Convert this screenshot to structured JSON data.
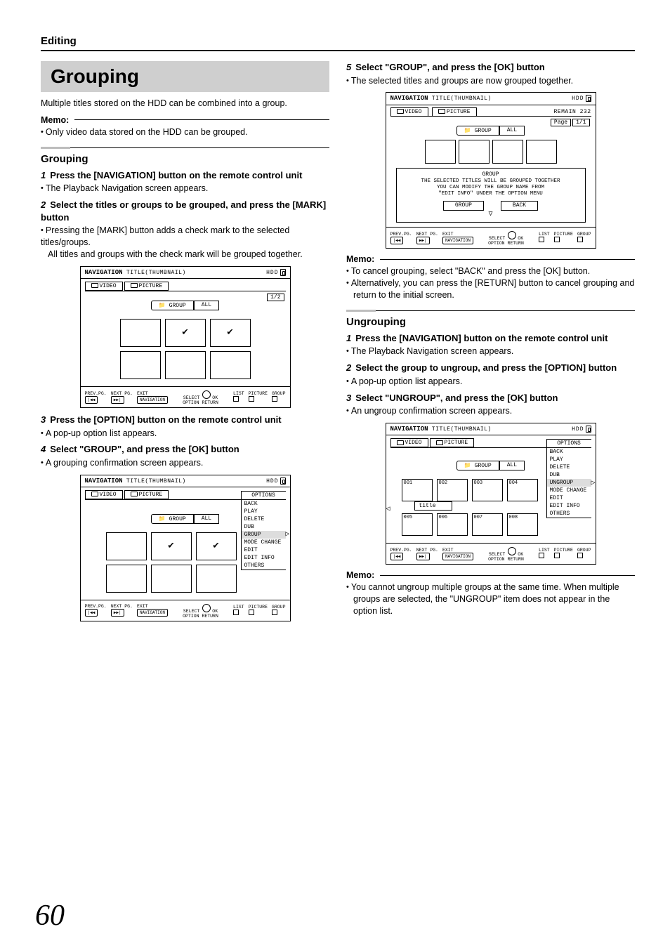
{
  "header": {
    "section": "Editing"
  },
  "left": {
    "title": "Grouping",
    "intro": "Multiple titles stored on the HDD can be combined into a group.",
    "memo1": {
      "label": "Memo:",
      "items": [
        "Only video data stored on the HDD can be grouped."
      ]
    },
    "sub1": {
      "heading": "Grouping",
      "s1": {
        "num": "1",
        "text": "Press the [NAVIGATION] button on the remote control unit",
        "note": "The Playback Navigation screen appears."
      },
      "s2": {
        "num": "2",
        "text": "Select the titles or groups to be grouped, and press the [MARK] button",
        "note": "Pressing the [MARK] button adds a check mark to the selected titles/groups.",
        "note2": "All titles and groups with the check mark will be grouped together."
      },
      "s3": {
        "num": "3",
        "text": "Press the [OPTION] button on the remote control unit",
        "note": "A pop-up option list appears."
      },
      "s4": {
        "num": "4",
        "text": "Select \"GROUP\", and press the [OK] button",
        "note": "A grouping confirmation screen appears."
      }
    },
    "fig_common": {
      "navtitle": "NAVIGATION",
      "navsub": "TITLE(THUMBNAIL)",
      "hdd": "HDD",
      "tab_video": "VIDEO",
      "tab_picture": "PICTURE",
      "btn_group": "GROUP",
      "btn_all": "ALL",
      "foot_prev": "PREV.PG.",
      "foot_next": "NEXT PG.",
      "foot_exit": "EXIT",
      "foot_select": "SELECT",
      "foot_ok": "OK",
      "foot_option": "OPTION",
      "foot_return": "RETURN",
      "foot_list": "LIST",
      "foot_picture": "PICTURE",
      "foot_group": "GROUP",
      "page12": "1/2",
      "options": "OPTIONS"
    },
    "fig2": {
      "menu": [
        "BACK",
        "PLAY",
        "DELETE",
        "DUB",
        "GROUP",
        "MODE CHANGE",
        "EDIT",
        "EDIT INFO",
        "OTHERS"
      ],
      "sel": "GROUP"
    }
  },
  "right": {
    "s5": {
      "num": "5",
      "text": "Select \"GROUP\", and press the [OK] button",
      "note": "The selected titles and groups are now grouped together."
    },
    "fig3": {
      "remain": "REMAIN 232",
      "page": "Page",
      "page11": "1/1",
      "dlg_title": "GROUP",
      "dlg_l1": "THE SELECTED TITLES WILL BE GROUPED TOGETHER",
      "dlg_l2": "YOU CAN MODIFY THE GROUP NAME FROM",
      "dlg_l3": "\"EDIT INFO\"  UNDER THE OPTION MENU",
      "btn_group": "GROUP",
      "btn_back": "BACK"
    },
    "memo2": {
      "label": "Memo:",
      "items": [
        "To cancel grouping, select \"BACK\" and press the [OK] button.",
        "Alternatively, you can press the [RETURN] button to cancel grouping and return to the initial screen."
      ]
    },
    "sub2": {
      "heading": "Ungrouping",
      "s1": {
        "num": "1",
        "text": "Press the [NAVIGATION] button on the remote control unit",
        "note": "The Playback Navigation screen appears."
      },
      "s2": {
        "num": "2",
        "text": "Select the group to ungroup, and press the [OPTION] button",
        "note": "A pop-up option list appears."
      },
      "s3": {
        "num": "3",
        "text": "Select \"UNGROUP\", and press the [OK] button",
        "note": "An ungroup confirmation screen appears."
      }
    },
    "fig4": {
      "menu": [
        "BACK",
        "PLAY",
        "DELETE",
        "DUB",
        "UNGROUP",
        "MODE CHANGE",
        "EDIT",
        "EDIT INFO",
        "OTHERS"
      ],
      "sel": "UNGROUP",
      "title_label": "title",
      "tnums": [
        "001",
        "002",
        "003",
        "004",
        "005",
        "006",
        "007",
        "008"
      ]
    },
    "memo3": {
      "label": "Memo:",
      "items": [
        "You cannot ungroup multiple groups at the same time. When multiple groups are selected, the \"UNGROUP\" item does not appear in the option list."
      ]
    }
  },
  "pagenum": "60"
}
